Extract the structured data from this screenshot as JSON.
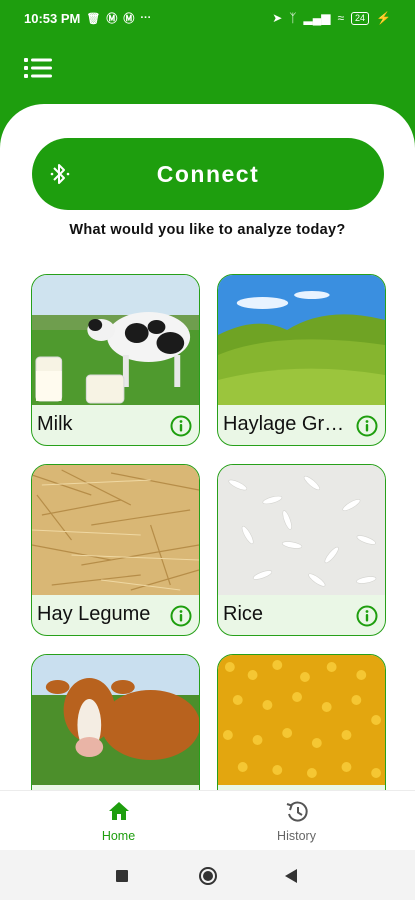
{
  "status_bar": {
    "time": "10:53 PM",
    "battery": "24",
    "left_icons": [
      "trash-icon",
      "notification-icon",
      "notification-icon",
      "more-icon"
    ],
    "right_icons": [
      "location-icon",
      "bluetooth-icon",
      "signal-icon",
      "wifi-icon",
      "battery-icon",
      "charging-icon"
    ]
  },
  "header": {
    "menu_icon": "list-menu-icon"
  },
  "connect": {
    "label": "Connect",
    "icon": "bluetooth-icon"
  },
  "prompt": "What would you like to analyze today?",
  "tiles": [
    {
      "label": "Milk",
      "image": "cow-meadow-milk"
    },
    {
      "label": "Haylage Grass",
      "image": "grass-field"
    },
    {
      "label": "Hay Legume",
      "image": "dry-hay"
    },
    {
      "label": "Rice",
      "image": "rice-grains"
    },
    {
      "label": "",
      "image": "cow"
    },
    {
      "label": "",
      "image": "corn-kernels"
    }
  ],
  "bottom_nav": {
    "home": "Home",
    "history": "History",
    "active": "home",
    "active_color": "#1e9e0e",
    "inactive_color": "#666666"
  },
  "colors": {
    "brand_green": "#1e9e0e",
    "tile_border": "#27a01a",
    "tile_label_bg": "#eaf7e6"
  }
}
